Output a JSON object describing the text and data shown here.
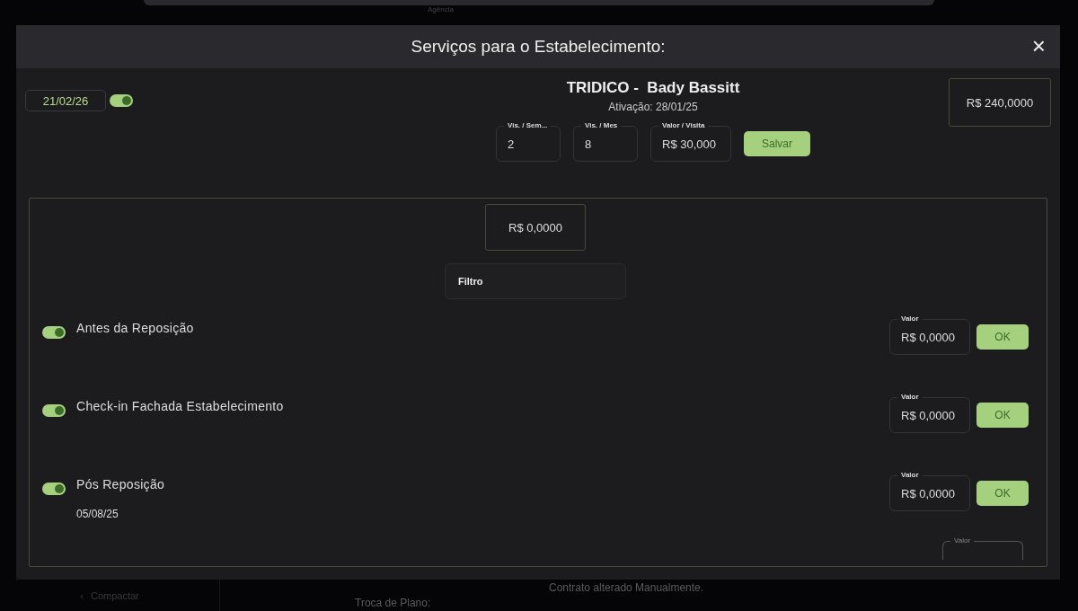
{
  "background": {
    "top_label": "Agência",
    "collapse_link": {
      "icon": "‹",
      "label": "Compactar"
    },
    "log_text": "Contrato alterado Manualmente.",
    "log_label": "Troca de Plano:"
  },
  "dialog": {
    "title": "Serviços para o Estabelecimento:",
    "close": "×",
    "date": "21/02/26",
    "date_toggle_on": true,
    "store_name": "TRIDICO -  Bady Bassitt",
    "activation": "Ativação: 28/01/25",
    "total": "R$ 240,0000",
    "fields": [
      {
        "label": "Vis. / Sem...",
        "value": "2"
      },
      {
        "label": "Vis. / Mes",
        "value": "8"
      },
      {
        "label": "Valor / Visita",
        "value": "R$ 30,000"
      }
    ],
    "save_button": "Salvar",
    "panel": {
      "subtotal": "R$ 0,0000",
      "filter_placeholder": "Filtro",
      "services": [
        {
          "name": "Antes da Reposição",
          "on": true,
          "value_label": "Valor",
          "value": "R$ 0,0000",
          "button": "OK"
        },
        {
          "name": "Check-in Fachada Estabelecimento",
          "on": true,
          "value_label": "Valor",
          "value": "R$ 0,0000",
          "button": "OK"
        },
        {
          "name": "Pós Reposição",
          "on": true,
          "date": "05/08/25",
          "value_label": "Valor",
          "value": "R$ 0,0000",
          "button": "OK"
        }
      ],
      "partial_field": {
        "label": "Valor"
      }
    }
  }
}
